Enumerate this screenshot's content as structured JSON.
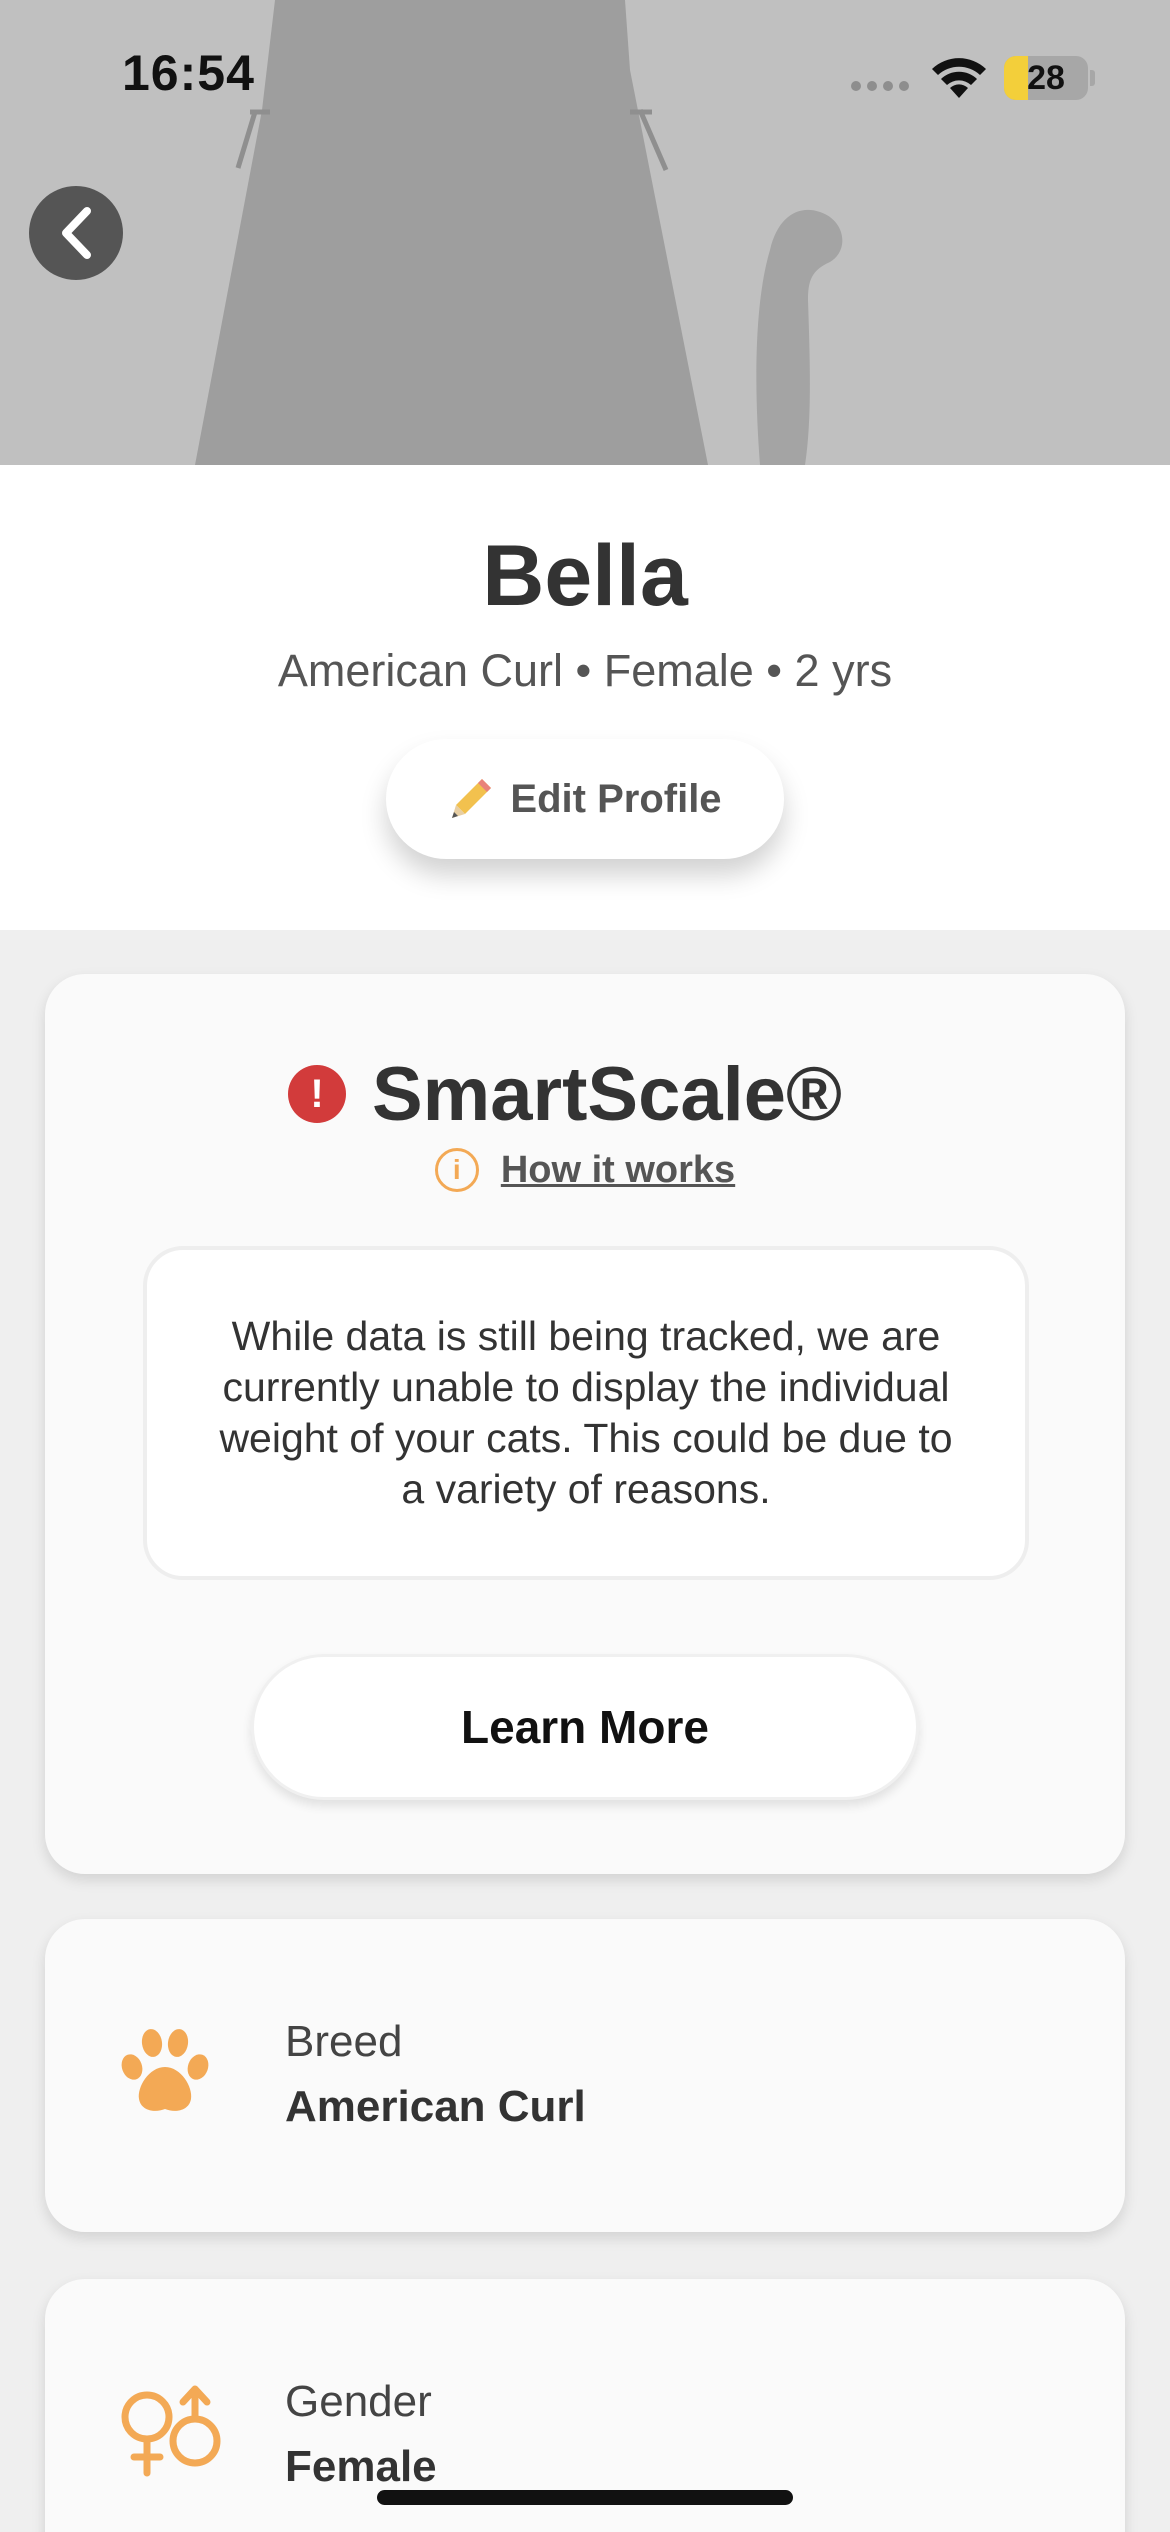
{
  "status_bar": {
    "time": "16:54",
    "battery": "28",
    "battery_level": 0.28,
    "battery_color": "#f3cf3a"
  },
  "hero": {
    "back_icon": "chevron-left-icon",
    "image": "cat-silhouette"
  },
  "profile": {
    "name": "Bella",
    "summary": "American Curl • Female • 2 yrs",
    "edit_button": {
      "icon": "pencil-icon",
      "label": "Edit Profile"
    }
  },
  "smartscale": {
    "alert_icon": "alert-circle-icon",
    "title": "SmartScale®",
    "how_it_works": {
      "icon": "info-icon",
      "label": "How it works"
    },
    "message": "While data is still being tracked, we are currently unable to display the individual weight of your cats. This could be due to a variety of reasons.",
    "learn_more_label": "Learn More"
  },
  "details": [
    {
      "icon": "paw-icon",
      "label": "Breed",
      "value": "American Curl"
    },
    {
      "icon": "gender-icon",
      "label": "Gender",
      "value": "Female"
    }
  ],
  "colors": {
    "accent": "#f3a955",
    "alert": "#d23b3b",
    "page_background": "#efefef",
    "hero_background": "#c0c0c0"
  }
}
